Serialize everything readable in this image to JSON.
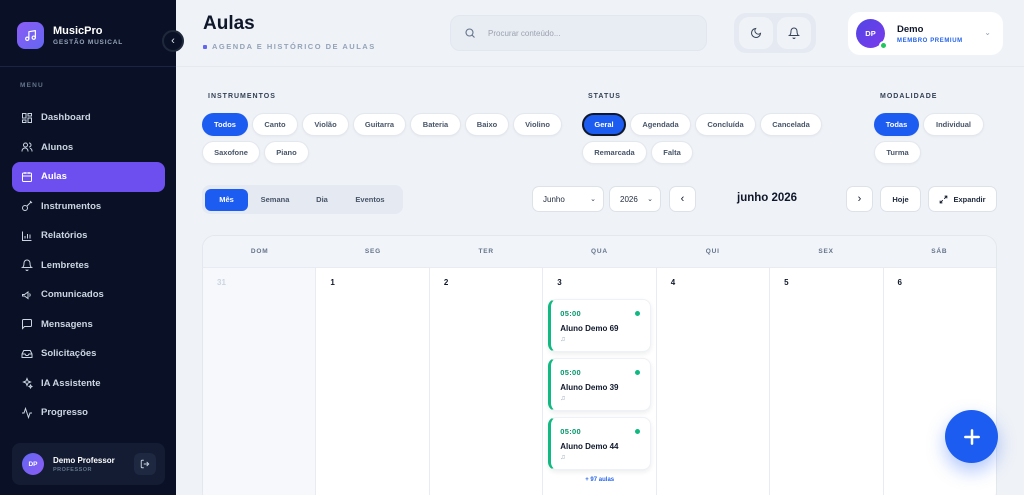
{
  "brand": {
    "name": "MusicPro",
    "subtitle": "GESTÃO MUSICAL"
  },
  "sidebar": {
    "menu_label": "MENU",
    "items": [
      {
        "label": "Dashboard",
        "icon": "dashboard-icon"
      },
      {
        "label": "Alunos",
        "icon": "users-icon"
      },
      {
        "label": "Aulas",
        "icon": "calendar-icon",
        "active": true
      },
      {
        "label": "Instrumentos",
        "icon": "guitar-icon"
      },
      {
        "label": "Relatórios",
        "icon": "bar-chart-icon"
      },
      {
        "label": "Lembretes",
        "icon": "bell-icon"
      },
      {
        "label": "Comunicados",
        "icon": "megaphone-icon"
      },
      {
        "label": "Mensagens",
        "icon": "message-icon"
      },
      {
        "label": "Solicitações",
        "icon": "inbox-icon"
      },
      {
        "label": "IA Assistente",
        "icon": "sparkles-icon"
      },
      {
        "label": "Progresso",
        "icon": "activity-icon"
      }
    ],
    "user": {
      "initials": "DP",
      "name": "Demo Professor",
      "role": "PROFESSOR"
    }
  },
  "header": {
    "title": "Aulas",
    "subtitle": "AGENDA E HISTÓRICO DE AULAS",
    "search_placeholder": "Procurar conteúdo...",
    "profile": {
      "initials": "DP",
      "name": "Demo",
      "tier": "MEMBRO PREMIUM"
    }
  },
  "filters": {
    "instrumentos": {
      "label": "INSTRUMENTOS",
      "options": [
        "Todos",
        "Canto",
        "Violão",
        "Guitarra",
        "Bateria",
        "Baixo",
        "Violino",
        "Saxofone",
        "Piano"
      ],
      "selected": "Todos"
    },
    "status": {
      "label": "STATUS",
      "options": [
        "Geral",
        "Agendada",
        "Concluída",
        "Cancelada",
        "Remarcada",
        "Falta"
      ],
      "selected": "Geral"
    },
    "modalidade": {
      "label": "MODALIDADE",
      "options": [
        "Todas",
        "Individual",
        "Turma"
      ],
      "selected": "Todas"
    }
  },
  "toolbar": {
    "view_tabs": [
      "Mês",
      "Semana",
      "Dia",
      "Eventos"
    ],
    "active_view": "Mês",
    "month_select": "Junho",
    "year_select": "2026",
    "current_period": "junho 2026",
    "today_label": "Hoje",
    "expand_label": "Expandir"
  },
  "calendar": {
    "weekdays": [
      "DOM",
      "SEG",
      "TER",
      "QUA",
      "QUI",
      "SEX",
      "SÁB"
    ],
    "days": [
      "31",
      "1",
      "2",
      "3",
      "4",
      "5",
      "6"
    ],
    "events_day": "3",
    "events": [
      {
        "time": "05:00",
        "student": "Aluno Demo 69"
      },
      {
        "time": "05:00",
        "student": "Aluno Demo 39"
      },
      {
        "time": "05:00",
        "student": "Aluno Demo 44"
      }
    ],
    "more_label": "+ 97 aulas"
  },
  "colors": {
    "primary": "#1d5cf0",
    "sidebar_bg": "#0a1126",
    "active_nav": "#6d4ff0",
    "event_accent": "#10b981"
  }
}
